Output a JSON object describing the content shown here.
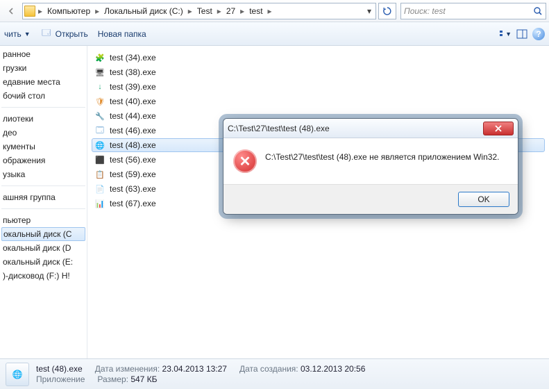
{
  "breadcrumb": {
    "items": [
      "Компьютер",
      "Локальный диск (C:)",
      "Test",
      "27",
      "test"
    ]
  },
  "search": {
    "placeholder": "Поиск: test"
  },
  "toolbar": {
    "organize": "чить",
    "open": "Открыть",
    "newfolder": "Новая папка"
  },
  "sidebar": {
    "favorites": {
      "items": [
        "ранное",
        "грузки",
        "едавние места",
        "бочий стол"
      ]
    },
    "libraries": {
      "items": [
        "лиотеки",
        "део",
        "кументы",
        "ображения",
        "узыка"
      ]
    },
    "homegroup": {
      "item": "ашняя группа"
    },
    "computer": {
      "label": "пьютер",
      "drives": [
        "окальный диск (C",
        "окальный диск (D",
        "окальный диск (E:",
        ")-дисковод (F:) H!"
      ]
    }
  },
  "files": [
    {
      "name": "test (34).exe",
      "ico": "🧩",
      "clr": "#3a7bd5"
    },
    {
      "name": "test (38).exe",
      "ico": "🖥",
      "clr": "#444"
    },
    {
      "name": "test (39).exe",
      "ico": "↓",
      "clr": "#2a7"
    },
    {
      "name": "test (40).exe",
      "ico": "🛡",
      "clr": "#e08b2c"
    },
    {
      "name": "test (44).exe",
      "ico": "🔧",
      "clr": "#c33"
    },
    {
      "name": "test (46).exe",
      "ico": "🗔",
      "clr": "#2a7bbf"
    },
    {
      "name": "test (48).exe",
      "ico": "🌐",
      "clr": "#2a5db0",
      "selected": true
    },
    {
      "name": "test (56).exe",
      "ico": "⬛",
      "clr": "#888"
    },
    {
      "name": "test (59).exe",
      "ico": "📋",
      "clr": "#b88"
    },
    {
      "name": "test (63).exe",
      "ico": "📄",
      "clr": "#6aa"
    },
    {
      "name": "test (67).exe",
      "ico": "📊",
      "clr": "#8a4cc0"
    }
  ],
  "status": {
    "filename": "test (48).exe",
    "modified_label": "Дата изменения:",
    "modified_value": "23.04.2013 13:27",
    "created_label": "Дата создания:",
    "created_value": "03.12.2013 20:56",
    "type": "Приложение",
    "size_label": "Размер:",
    "size_value": "547 КБ"
  },
  "dialog": {
    "title": "C:\\Test\\27\\test\\test (48).exe",
    "message": "C:\\Test\\27\\test\\test (48).exe не является приложением Win32.",
    "ok": "OK"
  }
}
